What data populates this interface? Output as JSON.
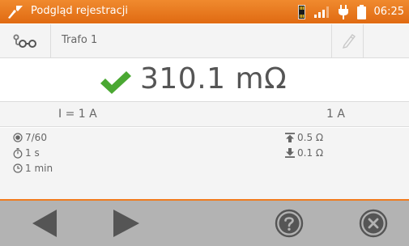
{
  "header": {
    "title": "Podgląd rejestracji",
    "time": "06:25",
    "icons": [
      "probe-icon",
      "sd-card-icon",
      "signal-icon",
      "power-plug-icon",
      "battery-icon"
    ]
  },
  "record": {
    "location_icon": "location-tree-icon",
    "name": "Trafo 1",
    "edit_icon": "pencil-icon"
  },
  "result": {
    "status_icon": "check-icon",
    "value": "310.1 mΩ"
  },
  "current": {
    "label": "I = 1 A",
    "value": "1 A"
  },
  "params": {
    "count": "7/60",
    "duration": "1 s",
    "interval": "1 min",
    "upper_limit": "0.5 Ω",
    "lower_limit": "0.1 Ω"
  },
  "footer": {
    "buttons": [
      "prev-arrow",
      "next-arrow",
      "help",
      "close"
    ]
  },
  "colors": {
    "accent": "#f07b1e",
    "check": "#4aa832",
    "footer_bg": "#b3b3b3",
    "footer_icon": "#555555"
  }
}
